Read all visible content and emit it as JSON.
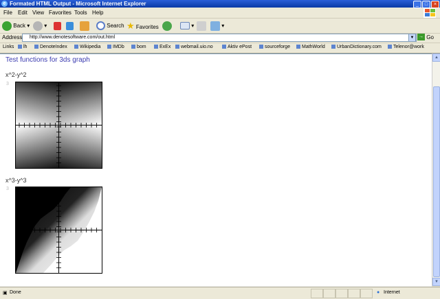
{
  "window": {
    "title": "Formated HTML Output - Microsoft Internet Explorer"
  },
  "menu": [
    "File",
    "Edit",
    "View",
    "Favorites",
    "Tools",
    "Help"
  ],
  "toolbar": {
    "back": "Back",
    "search": "Search",
    "favorites": "Favorites"
  },
  "address": {
    "label": "Address",
    "url": "http://www.denotesoftware.com/out.html",
    "go": "Go"
  },
  "links": {
    "label": "Links",
    "items": [
      "lh",
      "DenoteIndex",
      "Wikipedia",
      "IMDb",
      "bom",
      "ExEx",
      "webmail.uio.no",
      "Aktiv ePost",
      "sourceforge",
      "MathWorld",
      "UrbanDictionary.com",
      "Telenor@work"
    ]
  },
  "page": {
    "title": "Test functions for 3ds graph",
    "sections": [
      {
        "label": "x^2-y^2",
        "mark": "3"
      },
      {
        "label": "x^3-y^3",
        "mark": "3"
      }
    ]
  },
  "status": {
    "left": "Done",
    "zone": "Internet"
  }
}
